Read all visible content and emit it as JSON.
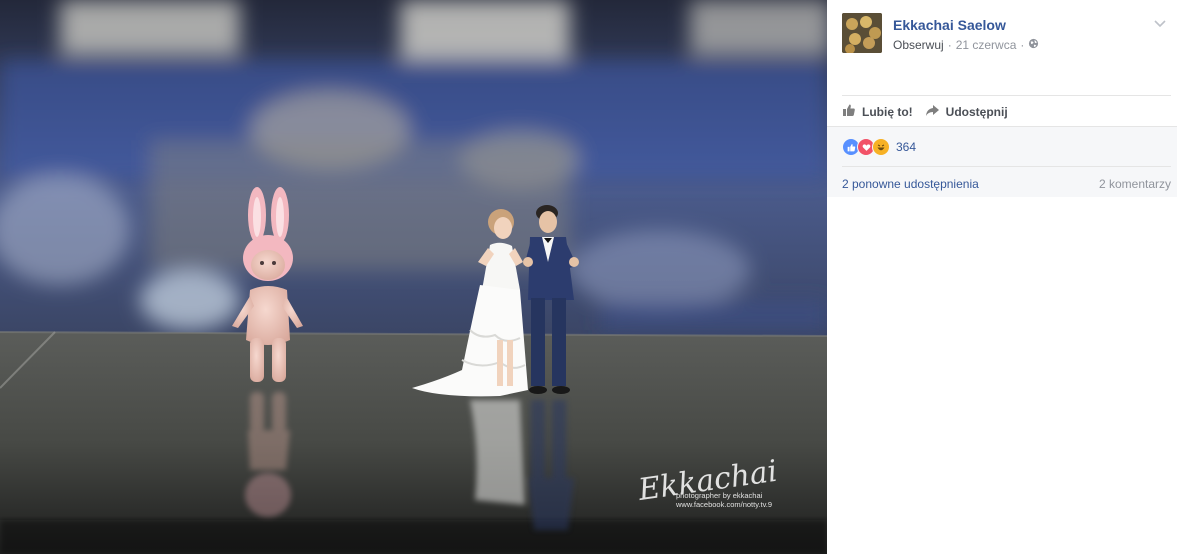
{
  "post": {
    "author": "Ekkachai Saelow",
    "follow_label": "Obserwuj",
    "separator": "·",
    "date": "21 czerwca",
    "privacy_icon": "globe-icon",
    "menu_icon": "chevron-down-icon"
  },
  "photo": {
    "watermark_signature": "Ekkachai",
    "watermark_credit": "photographer by ekkachai",
    "watermark_url": "www.facebook.com/notty.tv.9"
  },
  "actions": {
    "like_label": "Lubię to!",
    "like_icon": "thumbs-up-icon",
    "share_label": "Udostępnij",
    "share_icon": "share-arrow-icon"
  },
  "feedback": {
    "reaction_icons": [
      "like-reaction-icon",
      "love-reaction-icon",
      "haha-reaction-icon"
    ],
    "reaction_colors": [
      "#5890ff",
      "#f25268",
      "#f7b125"
    ],
    "reaction_count": "364",
    "shares_label": "2 ponowne udostępnienia",
    "comments_label": "2 komentarzy"
  }
}
